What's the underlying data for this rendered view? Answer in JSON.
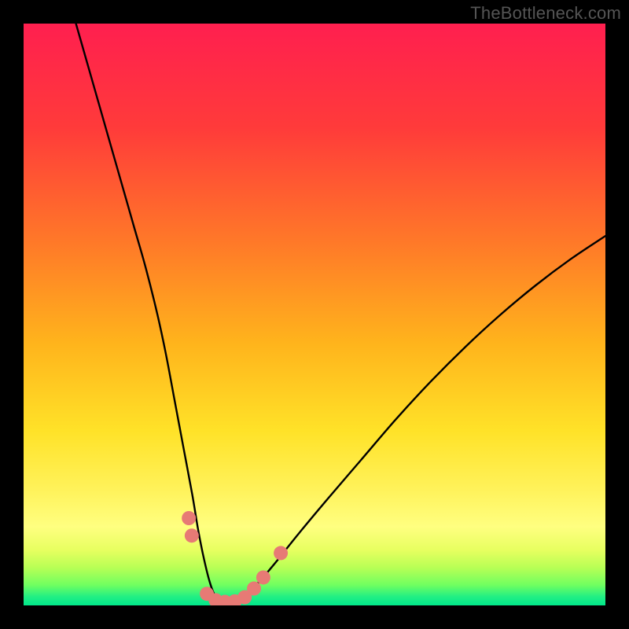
{
  "watermark": "TheBottleneck.com",
  "chart_data": {
    "type": "line",
    "title": "",
    "xlabel": "",
    "ylabel": "",
    "xlim": [
      0,
      100
    ],
    "ylim": [
      0,
      100
    ],
    "grid": false,
    "legend": false,
    "background_gradient_stops": [
      {
        "offset": 0.0,
        "color": "#ff1f4f"
      },
      {
        "offset": 0.18,
        "color": "#ff3b3a"
      },
      {
        "offset": 0.38,
        "color": "#ff7a28"
      },
      {
        "offset": 0.55,
        "color": "#ffb41c"
      },
      {
        "offset": 0.7,
        "color": "#ffe228"
      },
      {
        "offset": 0.8,
        "color": "#fff25a"
      },
      {
        "offset": 0.865,
        "color": "#ffff80"
      },
      {
        "offset": 0.905,
        "color": "#e7ff60"
      },
      {
        "offset": 0.935,
        "color": "#b8ff55"
      },
      {
        "offset": 0.965,
        "color": "#70ff60"
      },
      {
        "offset": 0.985,
        "color": "#22ef84"
      },
      {
        "offset": 1.0,
        "color": "#00e78a"
      }
    ],
    "series": [
      {
        "name": "bottleneck-curve",
        "color": "#000000",
        "x": [
          9,
          11,
          13,
          15,
          17,
          19,
          21,
          23,
          24.5,
          26,
          27.5,
          29,
          30,
          31,
          32,
          33,
          34.5,
          36,
          38,
          40,
          43,
          47,
          52,
          58,
          64,
          70,
          76,
          82,
          88,
          94,
          100
        ],
        "y": [
          100,
          93,
          86,
          79,
          72,
          65,
          58,
          50,
          43,
          35,
          27,
          19,
          13,
          8,
          4,
          1.5,
          0.5,
          0.5,
          1.5,
          3.5,
          7,
          12,
          18,
          25,
          32,
          38.5,
          44.5,
          50,
          55,
          59.5,
          63.5
        ]
      }
    ],
    "markers": {
      "name": "highlight-dots",
      "color": "#e77a75",
      "radius_px": 9,
      "points": [
        {
          "x": 28.4,
          "y": 15.0
        },
        {
          "x": 28.9,
          "y": 12.0
        },
        {
          "x": 31.5,
          "y": 2.0
        },
        {
          "x": 33.0,
          "y": 0.9
        },
        {
          "x": 34.6,
          "y": 0.6
        },
        {
          "x": 36.3,
          "y": 0.7
        },
        {
          "x": 38.0,
          "y": 1.4
        },
        {
          "x": 39.6,
          "y": 2.9
        },
        {
          "x": 41.2,
          "y": 4.8
        },
        {
          "x": 44.2,
          "y": 9.0
        }
      ]
    }
  }
}
